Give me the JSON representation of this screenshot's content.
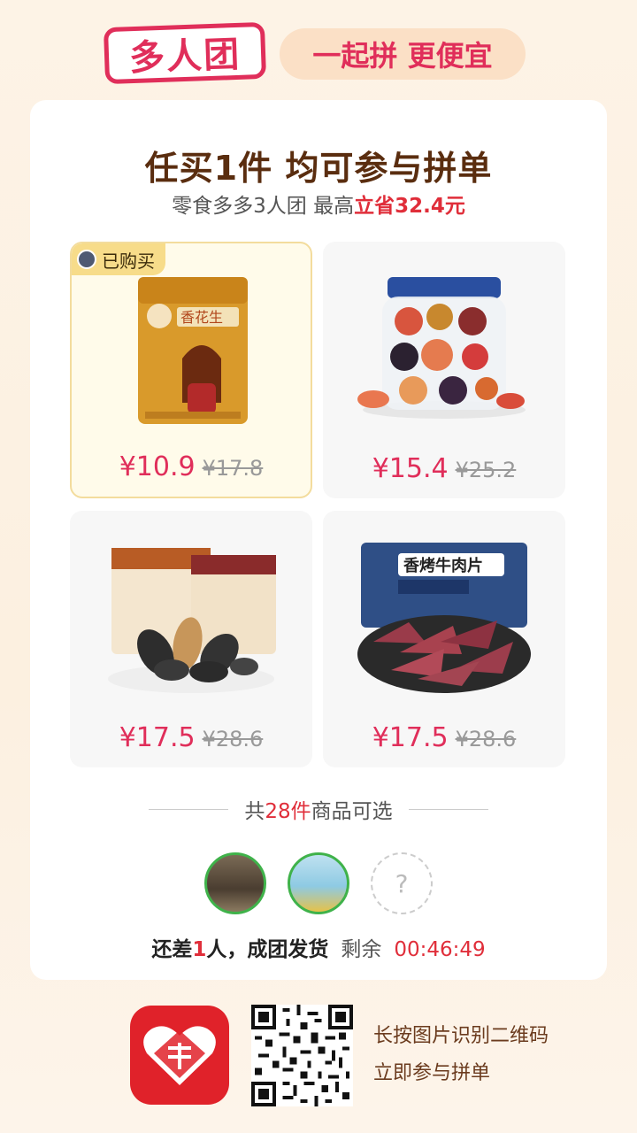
{
  "header": {
    "brand": "多人团",
    "slogan": "一起拼 更便宜"
  },
  "card": {
    "headline": "任买1件 均可参与拼单",
    "subline_prefix": "零食多多3人团 最高",
    "subline_highlight": "立省32.4元"
  },
  "products": [
    {
      "name": "香花生",
      "price": "¥10.9",
      "original_price": "¥17.8",
      "badge": "已购买",
      "selected": true
    },
    {
      "name": "果干罐",
      "price": "¥15.4",
      "original_price": "¥25.2"
    },
    {
      "name": "瓜子",
      "price": "¥17.5",
      "original_price": "¥28.6"
    },
    {
      "name": "香烤牛肉片",
      "price": "¥17.5",
      "original_price": "¥28.6"
    }
  ],
  "count": {
    "prefix": "共",
    "number": "28件",
    "suffix": "商品可选"
  },
  "group": {
    "empty_slot": "?",
    "status_prefix": "还差",
    "status_number": "1",
    "status_suffix": "人，成团发货",
    "remain_label": "剩余",
    "timer": "00:46:49"
  },
  "footer": {
    "line1": "长按图片识别二维码",
    "line2": "立即参与拼单"
  },
  "colors": {
    "accent": "#e02e5a",
    "highlight_red": "#e02e3a",
    "brown": "#5a2d0f",
    "logo_red": "#e0222a",
    "member_ring": "#3fb24a"
  }
}
